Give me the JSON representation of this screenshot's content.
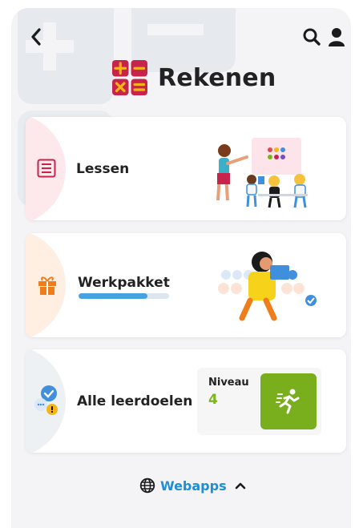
{
  "app": {
    "title": "Rekenen",
    "colors": {
      "brand": "#c8234b",
      "link": "#1e8ed6",
      "progress": "#46a2e0",
      "niveau_tile": "#79ae1c",
      "niveau_value": "#7bb51e"
    }
  },
  "header": {
    "back_icon": "chevron-left-icon",
    "search_icon": "search-icon",
    "profile_icon": "user-icon",
    "logo_icon": "math-operators-icon"
  },
  "cards": [
    {
      "label": "Lessen",
      "icon": "list-icon"
    },
    {
      "label": "Werkpakket",
      "icon": "gift-icon",
      "progress": 0.76
    },
    {
      "label": "Alle leerdoelen",
      "icon": "goals-status-icon",
      "niveau": {
        "label": "Niveau",
        "value": "4",
        "icon": "running-person-icon"
      }
    }
  ],
  "footer": {
    "webapps_label": "Webapps",
    "globe_icon": "globe-icon",
    "chevron_icon": "chevron-up-icon"
  }
}
